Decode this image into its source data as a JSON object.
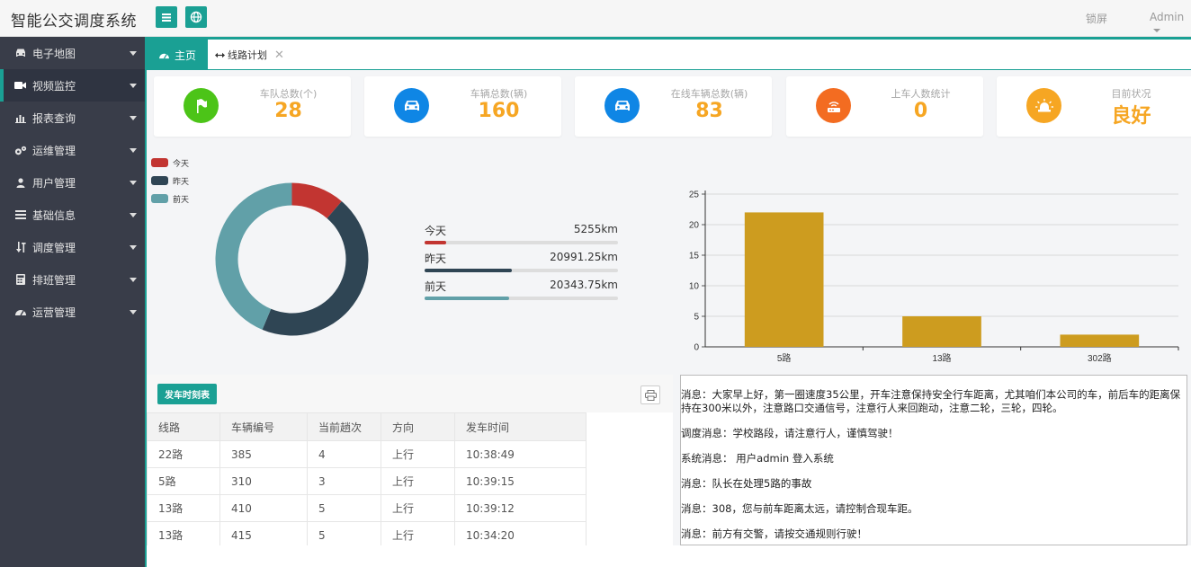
{
  "app": {
    "title": "智能公交调度系统"
  },
  "header": {
    "lock_label": "锁屏",
    "user_label": "Admin"
  },
  "sidebar": {
    "items": [
      {
        "label": "电子地图",
        "icon": "car-icon"
      },
      {
        "label": "视频监控",
        "icon": "video-icon",
        "active": true
      },
      {
        "label": "报表查询",
        "icon": "bar-chart-icon"
      },
      {
        "label": "运维管理",
        "icon": "cogs-icon"
      },
      {
        "label": "用户管理",
        "icon": "user-icon"
      },
      {
        "label": "基础信息",
        "icon": "list-icon"
      },
      {
        "label": "调度管理",
        "icon": "sort-icon"
      },
      {
        "label": "排班管理",
        "icon": "calculator-icon"
      },
      {
        "label": "运营管理",
        "icon": "dashboard-icon"
      }
    ]
  },
  "tabs": {
    "home": "主页",
    "route_plan": "线路计划",
    "close": "✕"
  },
  "stats": [
    {
      "label": "车队总数(个)",
      "value": "28",
      "color": "#4cc418",
      "icon": "flag-icon"
    },
    {
      "label": "车辆总数(辆)",
      "value": "160",
      "color": "#0f86e5",
      "icon": "car-icon"
    },
    {
      "label": "在线车辆总数(辆)",
      "value": "83",
      "color": "#0f86e5",
      "icon": "car-icon"
    },
    {
      "label": "上车人数统计",
      "value": "0",
      "color": "#f36c21",
      "icon": "router-icon"
    },
    {
      "label": "目前状况",
      "value": "良好",
      "color": "#f6a623",
      "icon": "alarm-icon"
    }
  ],
  "distance": {
    "legend": [
      "今天",
      "昨天",
      "前天"
    ],
    "colors": [
      "#c23531",
      "#2f4554",
      "#61a0a8"
    ],
    "rows": [
      {
        "label": "今天",
        "value": "5255km",
        "km": 5255
      },
      {
        "label": "昨天",
        "value": "20991.25km",
        "km": 20991.25
      },
      {
        "label": "前天",
        "value": "20343.75km",
        "km": 20343.75
      }
    ]
  },
  "chart_data": {
    "type": "bar",
    "categories": [
      "5路",
      "13路",
      "302路"
    ],
    "values": [
      22,
      5,
      2
    ],
    "ylim": [
      0,
      25
    ],
    "yticks": [
      "0",
      "5",
      "10",
      "15",
      "20",
      "25"
    ],
    "bar_color": "#cd9c1f",
    "grid": true
  },
  "schedule": {
    "button_label": "发车时刻表",
    "columns": [
      "线路",
      "车辆编号",
      "当前趟次",
      "方向",
      "发车时间"
    ],
    "rows": [
      [
        "22路",
        "385",
        "4",
        "上行",
        "10:38:49"
      ],
      [
        "5路",
        "310",
        "3",
        "上行",
        "10:39:15"
      ],
      [
        "13路",
        "410",
        "5",
        "上行",
        "10:39:12"
      ],
      [
        "13路",
        "415",
        "5",
        "上行",
        "10:34:20"
      ]
    ]
  },
  "messages": [
    "消息：大家早上好，第一圈速度35公里，开车注意保持安全行车距离，尤其咱们本公司的车，前后车的距离保持在300米以外，注意路口交通信号，注意行人来回跑动，注意二轮，三轮，四轮。",
    "调度消息：学校路段，请注意行人，谨慎驾驶！",
    "系统消息： 用户admin 登入系统",
    "消息：队长在处理5路的事故",
    "消息：308，您与前车距离太远，请控制合现车距。",
    "消息：前方有交警，请按交通规则行驶！"
  ]
}
